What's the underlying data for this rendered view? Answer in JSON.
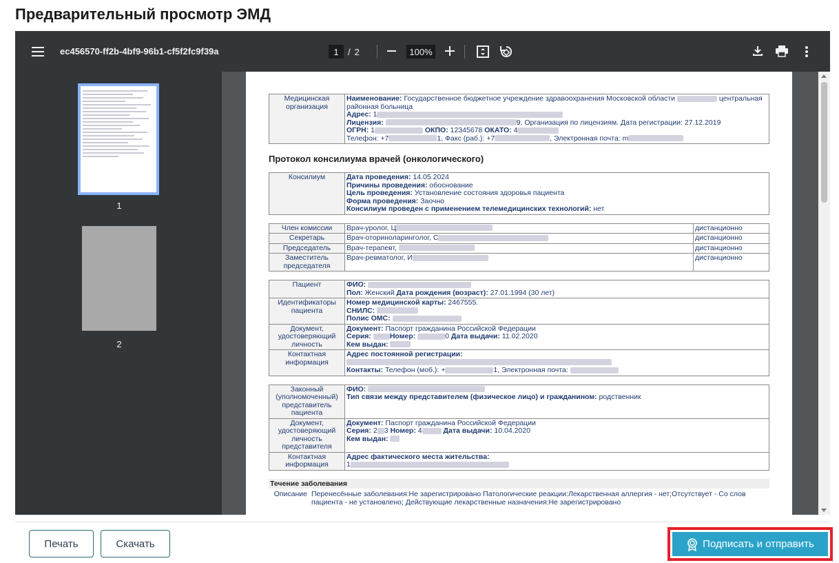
{
  "page": {
    "title": "Предварительный просмотр ЭМД"
  },
  "viewer": {
    "file_name": "ec456570-ff2b-4bf9-96b1-cf5f2fc9f39a",
    "page_current": "1",
    "page_separator": "/",
    "page_total": "2",
    "zoom": "100%",
    "thumbnails": [
      {
        "label": "1"
      },
      {
        "label": "2"
      }
    ],
    "icons": [
      "menu-icon",
      "fit-page-icon",
      "rotate-icon",
      "download-icon",
      "print-icon",
      "more-vert-icon"
    ]
  },
  "document": {
    "org": {
      "label": "Медицинская организация",
      "name_label": "Наименование:",
      "name_value": "Государственное бюджетное учреждение здравоохранения Московской области",
      "name_tail": "центральная районная больница",
      "address_label": "Адрес:",
      "address_value": "1",
      "license_label": "Лицензия:",
      "license_value": "9, Организация по лицензиям. Дата регистрации: 27.12.2019",
      "ogrn_label": "ОГРН:",
      "ogrn_value": "1",
      "okpo_label": "ОКПО:",
      "okpo_value": "12345678",
      "okato_label": "ОКАТО:",
      "okato_value": "4",
      "phone_text": "Телефон: +7",
      "fax_text": "1, Факс (раб.): +7",
      "email_text": ", Электронная почта: m"
    },
    "protocol_title": "Протокол консилиума врачей (онкологического)",
    "consilium": {
      "label": "Консилиум",
      "date_label": "Дата проведения:",
      "date_value": "14.05.2024",
      "reason_label": "Причины проведения:",
      "reason_value": "обоснование",
      "goal_label": "Цель проведения:",
      "goal_value": "Установление состояния здоровья пациента",
      "form_label": "Форма проведения:",
      "form_value": "Заочно",
      "tele_label": "Консилиум проведен с применением телемедицинских технологий:",
      "tele_value": "нет"
    },
    "commission": [
      {
        "role": "Член комиссии",
        "doctor": "Врач-уролог, Ц",
        "mode": "дистанционно"
      },
      {
        "role": "Секретарь",
        "doctor": "Врач-оториноларинголог, С",
        "mode": "дистанционно"
      },
      {
        "role": "Председатель",
        "doctor": "Врач-терапевт,",
        "mode": "дистанционно"
      },
      {
        "role": "Заместитель председателя",
        "doctor": "Врач-ревматолог, И",
        "mode": "дистанционно"
      }
    ],
    "patient": {
      "label": "Пациент",
      "fio_label": "ФИО:",
      "sex_label": "Пол:",
      "sex_value": "Женский",
      "dob_label": "Дата рождения (возраст):",
      "dob_value": "27.01.1994 (30 лет)",
      "ids_label": "Идентификаторы пациента",
      "card_label": "Номер медицинской карты:",
      "card_value": "2467555.",
      "snils_label": "СНИЛС:",
      "oms_label": "Полис ОМС:",
      "doc_label": "Документ, удостоверяющий личность",
      "doc_type_label": "Документ:",
      "doc_type_value": "Паспорт гражданина Российской Федерации",
      "series_label": "Серия:",
      "number_label": "Номер:",
      "number_value": "0",
      "issue_date_label": "Дата выдачи:",
      "issue_date_value": "11.02.2020",
      "issued_by_label": "Кем выдан:",
      "contact_label": "Контактная информация",
      "reg_addr_label": "Адрес постоянной регистрации:",
      "contacts_label": "Контакты:",
      "contacts_value": "Телефон (моб.): +",
      "contacts_tail": "1, Электронная почта:"
    },
    "representative": {
      "label": "Законный (уполномоченный) представитель пациента",
      "fio_label": "ФИО:",
      "rel_label": "Тип связи между представителем (физическое лицо) и гражданином:",
      "rel_value": "родственник",
      "doc_label": "Документ, удостоверяющий личность представителя",
      "doc_type_label": "Документ:",
      "doc_type_value": "Паспорт гражданина Российской Федерации",
      "series_label": "Серия:",
      "series_value": "2",
      "series_tail": "3",
      "number_label": "Номер:",
      "number_value": "4",
      "issue_date_label": "Дата выдачи:",
      "issue_date_value": "10.04.2020",
      "issued_by_label": "Кем выдан:",
      "contact_label": "Контактная информация",
      "addr_label": "Адрес фактического места жительства:",
      "addr_value": "1"
    },
    "course": {
      "title": "Течение заболевания",
      "desc_label": "Описание",
      "desc_value": "Перенесённые заболевания:Не зарегистрировано Патологические реакции:Лекарственная аллергия - нет;Отсутствует - Со слов пациента - не установлено; Действующие лекарственные назначения:Не зарегистрировано"
    }
  },
  "footer": {
    "print_label": "Печать",
    "download_label": "Скачать",
    "sign_label": "Подписать и отправить"
  },
  "colors": {
    "toolbar": "#323639",
    "viewer_bg": "#525659",
    "accent": "#2ba3c9",
    "highlight": "#e5202a"
  }
}
